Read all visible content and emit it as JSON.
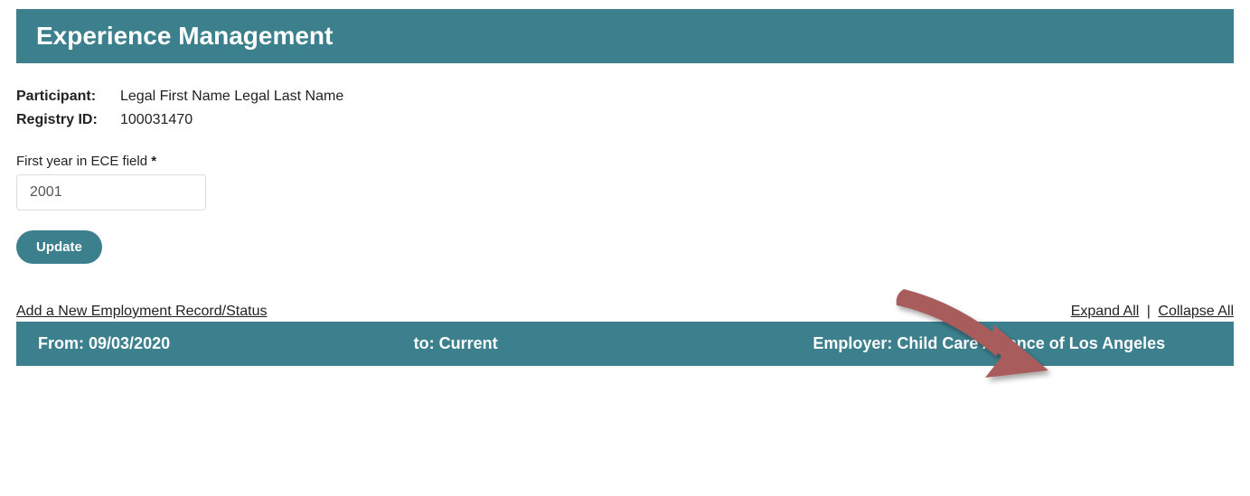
{
  "header": {
    "title": "Experience Management"
  },
  "participant": {
    "label": "Participant:",
    "value": "Legal First Name Legal Last Name"
  },
  "registry": {
    "label": "Registry ID:",
    "value": "100031470"
  },
  "firstYear": {
    "label": "First year in ECE field",
    "required": "*",
    "value": "2001"
  },
  "buttons": {
    "update": "Update"
  },
  "links": {
    "addRecord": "Add a New Employment Record/Status",
    "expandAll": "Expand All",
    "collapseAll": "Collapse All",
    "separator": "|"
  },
  "record": {
    "fromLabel": "From:",
    "fromValue": "09/03/2020",
    "toLabel": "to:",
    "toValue": "Current",
    "employerLabel": "Employer:",
    "employerValue": "Child Care Alliance of Los Angeles"
  }
}
